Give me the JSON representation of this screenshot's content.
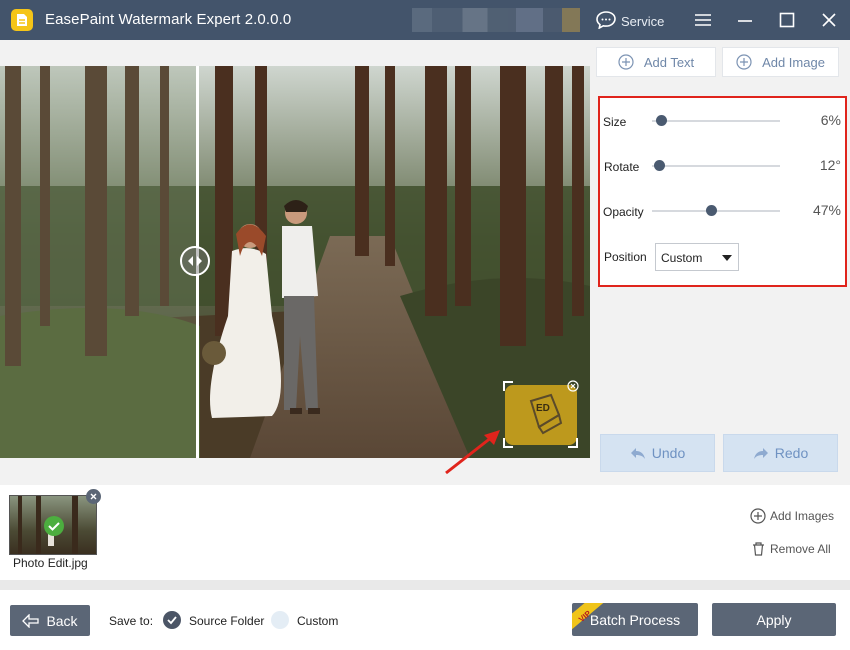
{
  "app": {
    "title": "EasePaint Watermark Expert  2.0.0.0"
  },
  "titlebar": {
    "service_label": "Service"
  },
  "toolbar": {
    "add_text_label": "Add Text",
    "add_image_label": "Add Image"
  },
  "settings": {
    "size": {
      "label": "Size",
      "value_text": "6%",
      "level": 0.06
    },
    "rotate": {
      "label": "Rotate",
      "value_text": "12°",
      "level": 0.03
    },
    "opacity": {
      "label": "Opacity",
      "value_text": "47%",
      "level": 0.47
    },
    "position": {
      "label": "Position",
      "selected": "Custom"
    }
  },
  "history": {
    "undo_label": "Undo",
    "redo_label": "Redo"
  },
  "files": {
    "items": [
      {
        "name": "Photo Edit.jpg"
      }
    ],
    "add_images_label": "Add Images",
    "remove_all_label": "Remove All"
  },
  "footer": {
    "back_label": "Back",
    "save_to_label": "Save to:",
    "source_folder_label": "Source Folder",
    "custom_label": "Custom",
    "batch_process_label": "Batch Process",
    "vip_badge": "VIP",
    "apply_label": "Apply"
  },
  "watermark": {
    "mark_text": "ED"
  },
  "colors": {
    "titlebar": "#43546b",
    "accent_red": "#e0241c",
    "button_dark": "#5b6676",
    "check_green": "#4cae3f"
  }
}
